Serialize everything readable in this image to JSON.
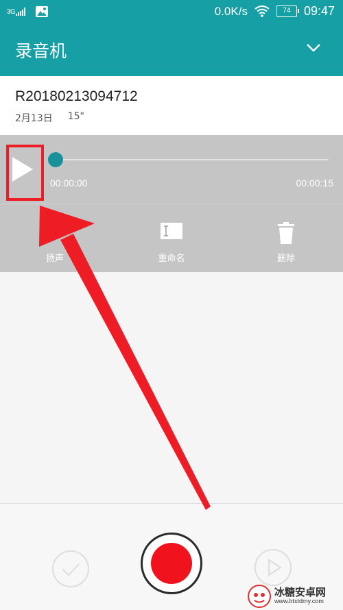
{
  "status_bar": {
    "network": "3G",
    "speed": "0.0K/s",
    "battery": "74",
    "time": "09:47"
  },
  "app_bar": {
    "title": "录音机",
    "menu_icon": "chevron-down-icon"
  },
  "recording": {
    "name": "R20180213094712",
    "date": "2月13日",
    "duration": "15\""
  },
  "player": {
    "play_icon": "play-icon",
    "current_time": "00:00:00",
    "total_time": "00:00:15",
    "progress": 0
  },
  "actions": [
    {
      "label": "扬声",
      "icon": "speaker-icon"
    },
    {
      "label": "重命名",
      "icon": "rename-icon"
    },
    {
      "label": "删除",
      "icon": "trash-icon"
    }
  ],
  "bottom_controls": {
    "confirm_icon": "check-icon",
    "record_icon": "record-icon",
    "play_icon": "play-outline-icon"
  },
  "annotation": {
    "highlight_color": "#ee1c25"
  },
  "watermark": {
    "name": "冰糖安卓网",
    "url": "www.btxtdmy.com"
  },
  "colors": {
    "primary": "#16a0a6",
    "record": "#f0121c",
    "panel": "#c5c5c5"
  }
}
